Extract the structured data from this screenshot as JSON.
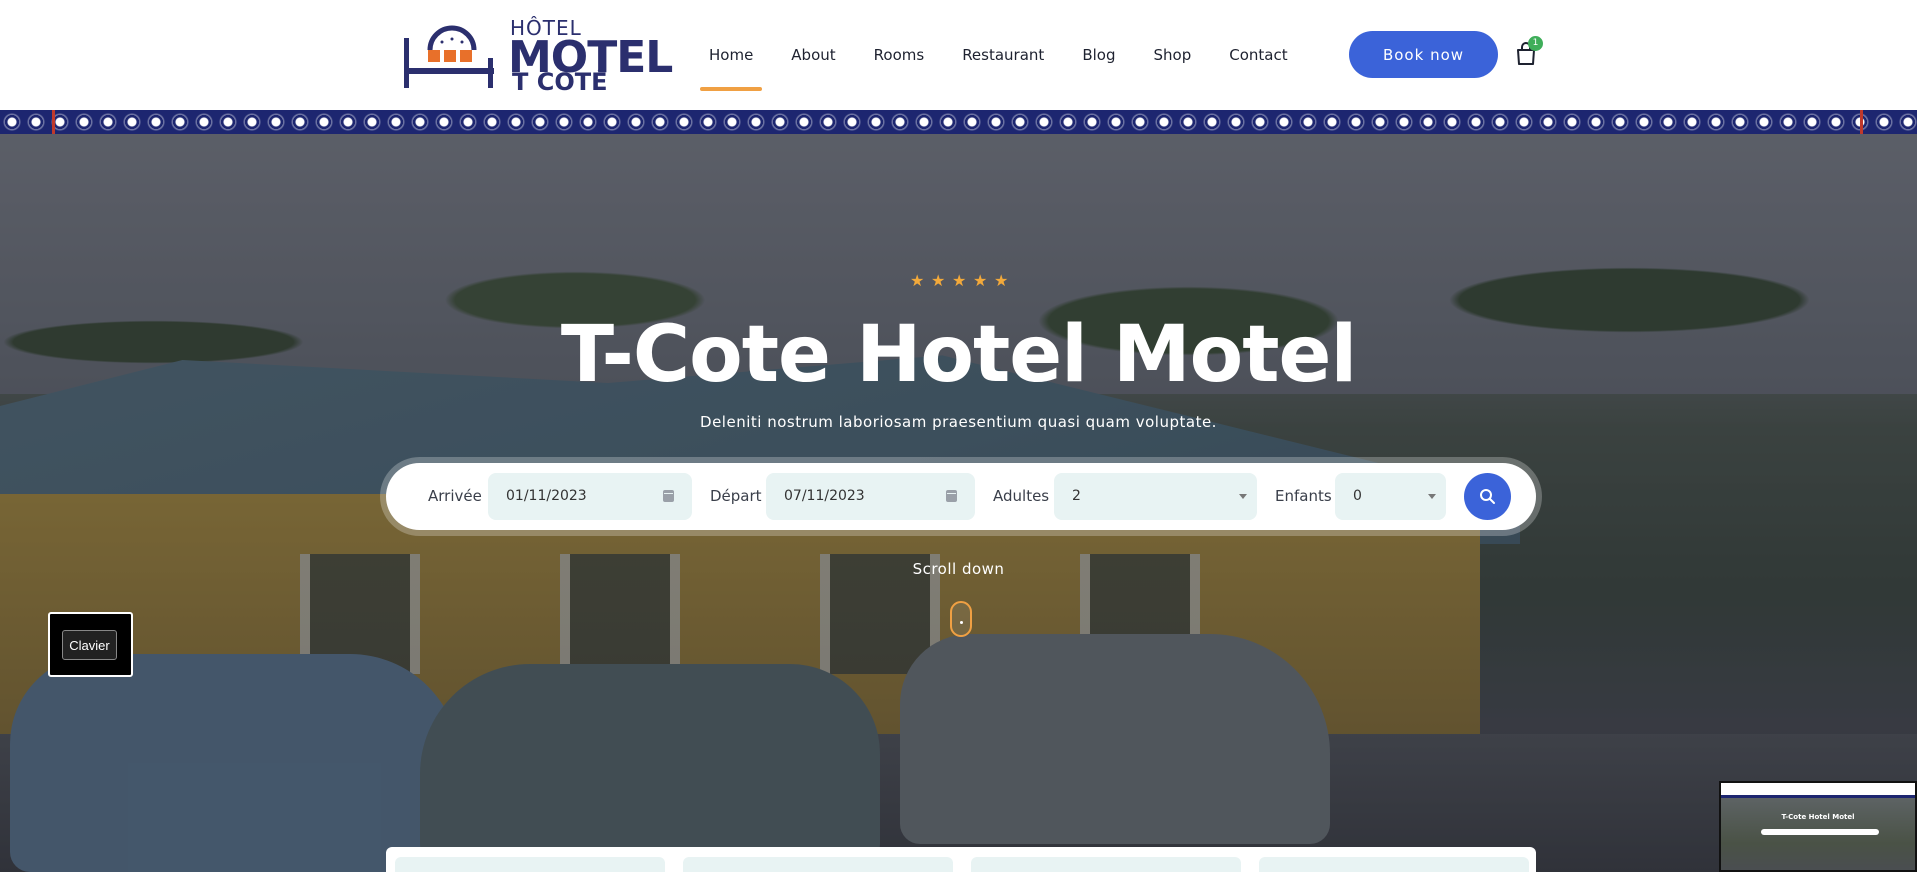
{
  "brand": {
    "logo_line1": "HÔTEL",
    "logo_line2": "MOTEL",
    "logo_line3": "T CÔTÉ",
    "primary_color": "#3b63d9",
    "navy_color": "#2b2f6e",
    "accent_color": "#f0a043"
  },
  "nav": {
    "items": [
      {
        "label": "Home",
        "active": true
      },
      {
        "label": "About"
      },
      {
        "label": "Rooms"
      },
      {
        "label": "Restaurant"
      },
      {
        "label": "Blog"
      },
      {
        "label": "Shop"
      },
      {
        "label": "Contact"
      }
    ],
    "book_label": "Book now",
    "cart_icon": "shopping-bag-icon",
    "cart_count": "1"
  },
  "hero": {
    "rating_stars": 5,
    "title": "T-Cote Hotel Motel",
    "subtitle": "Deleniti nostrum laboriosam praesentium quasi quam voluptate.",
    "scroll_label": "Scroll down"
  },
  "booking": {
    "arrival_label": "Arrivée",
    "arrival_value": "01/11/2023",
    "departure_label": "Départ",
    "departure_value": "07/11/2023",
    "adults_label": "Adultes",
    "adults_value": "2",
    "children_label": "Enfants",
    "children_value": "0",
    "search_icon": "search-icon"
  },
  "overlay": {
    "keyboard_button": "Clavier"
  },
  "thumbnail": {
    "title": "T-Cote Hotel Motel"
  }
}
